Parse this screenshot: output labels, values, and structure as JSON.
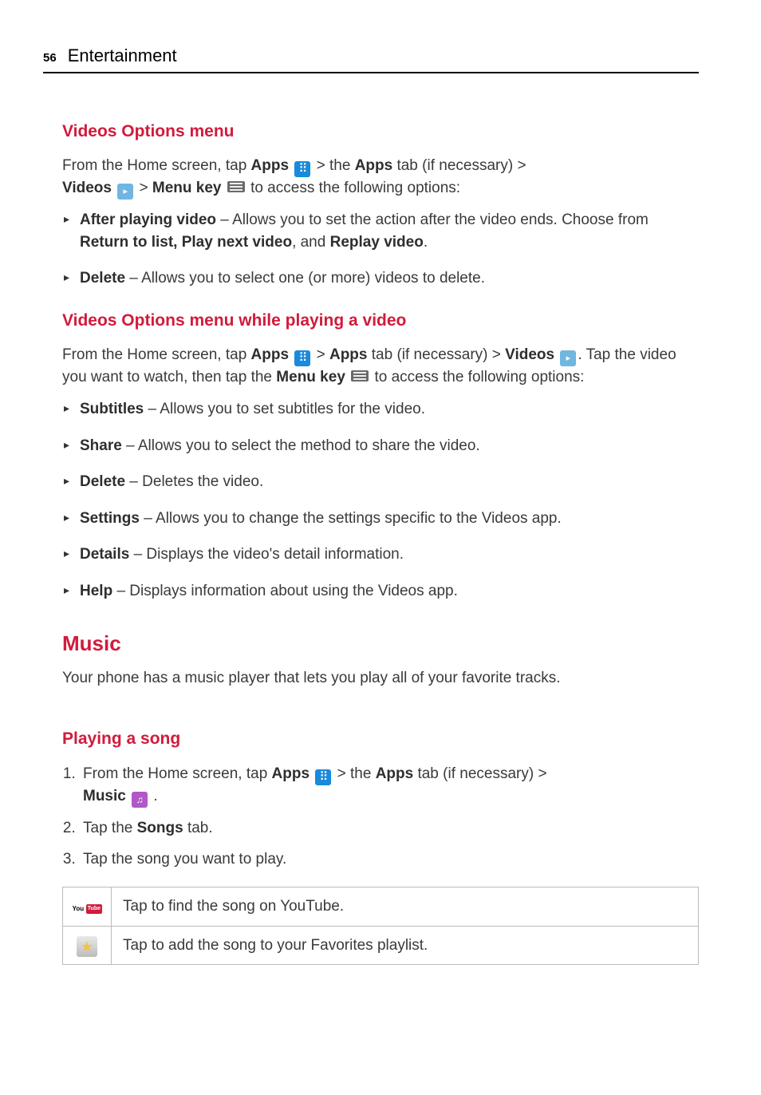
{
  "header": {
    "page_number": "56",
    "section": "Entertainment"
  },
  "s1": {
    "title": "Videos Options menu",
    "intro_a": "From the Home screen, tap ",
    "apps_label": "Apps",
    "intro_b": " > the ",
    "apps_tab": "Apps",
    "intro_c": " tab (if necessary) > ",
    "videos_label": "Videos",
    "intro_d": " > ",
    "menu_key": "Menu key",
    "intro_e": " to access the following options:",
    "items": [
      {
        "name": "After playing video",
        "desc_a": " – Allows you to set the action after the video ends. Choose from ",
        "opt": "Return to list, Play next video",
        "desc_b": ", and ",
        "opt2": "Replay video",
        "desc_c": "."
      },
      {
        "name": "Delete",
        "desc": " – Allows you to select one (or more) videos to delete."
      }
    ]
  },
  "s2": {
    "title": "Videos Options menu while playing a video",
    "intro_a": "From the Home screen, tap ",
    "apps_label": "Apps",
    "intro_b": " > ",
    "apps_tab": "Apps",
    "intro_c": " tab (if necessary) > ",
    "videos_label": "Videos",
    "intro_d": ". Tap the video you want to watch, then tap the ",
    "menu_key": "Menu key",
    "intro_e": " to access the following options:",
    "items": [
      {
        "name": "Subtitles",
        "desc": " – Allows you to set subtitles for the video."
      },
      {
        "name": "Share",
        "desc": " – Allows you to select the method to share the video."
      },
      {
        "name": "Delete",
        "desc": " – Deletes the video."
      },
      {
        "name": "Settings",
        "desc": " – Allows you to change the settings specific to the Videos app."
      },
      {
        "name": "Details",
        "desc": " – Displays the video's detail information."
      },
      {
        "name": "Help",
        "desc": " – Displays information about using the Videos app."
      }
    ]
  },
  "music": {
    "title": "Music",
    "intro": "Your phone has a music player that lets you play all of your favorite tracks."
  },
  "s3": {
    "title": "Playing a song",
    "step1_a": "From the Home screen, tap ",
    "apps_label": "Apps",
    "step1_b": " > the ",
    "apps_tab": "Apps",
    "step1_c": " tab (if necessary) > ",
    "music_label": "Music",
    "step1_d": " .",
    "step2_a": "Tap the ",
    "songs_tab": "Songs",
    "step2_b": " tab.",
    "step3": "Tap the song you want to play.",
    "table": [
      {
        "desc": "Tap to find the song on YouTube."
      },
      {
        "desc": "Tap to add the song to your Favorites playlist."
      }
    ]
  }
}
